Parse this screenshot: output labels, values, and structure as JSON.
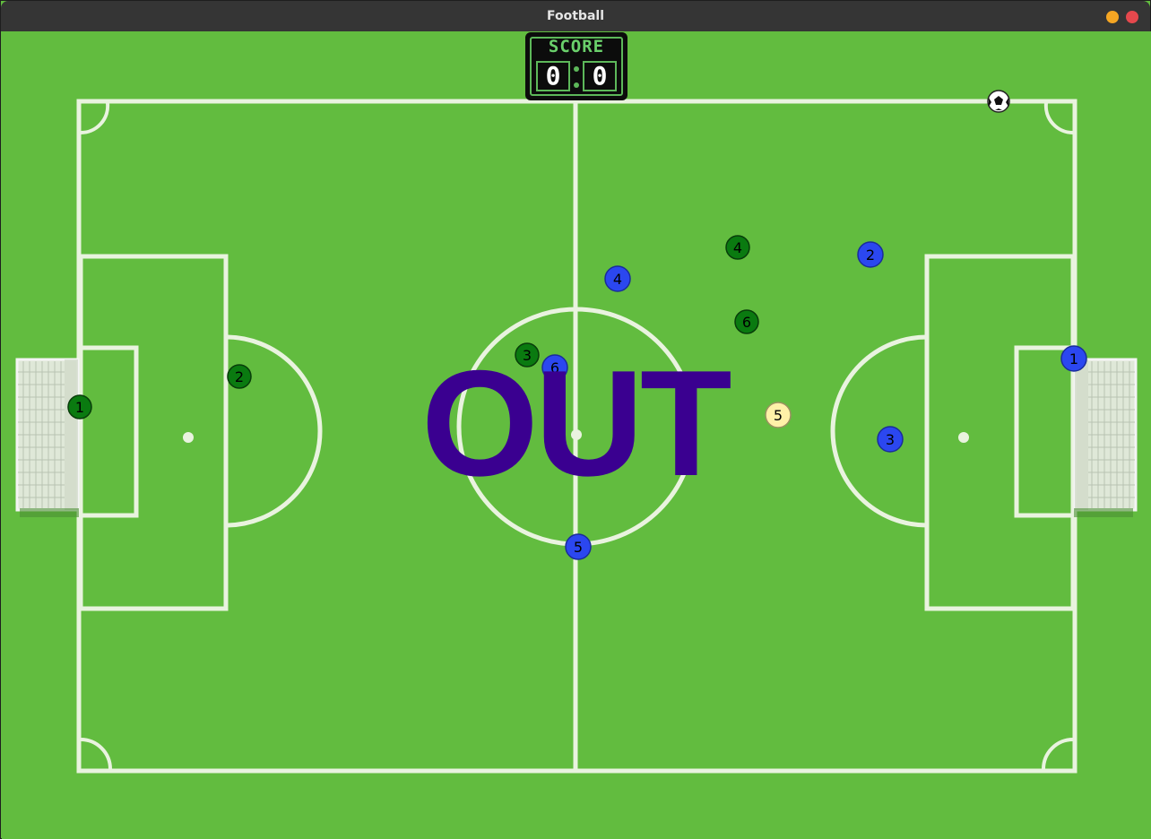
{
  "window": {
    "title": "Football"
  },
  "colors": {
    "grass": "#62bc3f",
    "lines": "#e9f3df",
    "team_green": "#0a7a10",
    "team_blue": "#2b47f0",
    "highlight_player": "#fff1a8",
    "out_text": "#3a0090"
  },
  "scoreboard": {
    "label": "SCORE",
    "left_score": "0",
    "right_score": "0"
  },
  "status": {
    "message": "OUT"
  },
  "ball": {
    "icon": "soccer-ball-icon"
  },
  "players": {
    "green": [
      {
        "number": "1",
        "team": "green"
      },
      {
        "number": "2",
        "team": "green"
      },
      {
        "number": "3",
        "team": "green"
      },
      {
        "number": "4",
        "team": "green"
      },
      {
        "number": "6",
        "team": "green"
      }
    ],
    "blue": [
      {
        "number": "1",
        "team": "blue"
      },
      {
        "number": "2",
        "team": "blue"
      },
      {
        "number": "3",
        "team": "blue"
      },
      {
        "number": "4",
        "team": "blue"
      },
      {
        "number": "5",
        "team": "blue"
      },
      {
        "number": "6",
        "team": "blue"
      }
    ],
    "highlighted": {
      "number": "5",
      "team": "highlight"
    }
  }
}
